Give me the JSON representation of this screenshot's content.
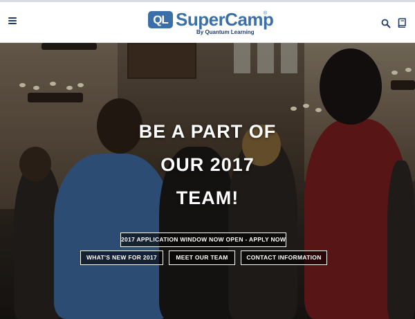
{
  "header": {
    "brand_mark": "QL",
    "brand_name": "SuperCamp",
    "brand_reg": "®",
    "brand_tagline": "By Quantum Learning",
    "icons": [
      "menu-icon",
      "search-icon",
      "book-icon"
    ],
    "colors": {
      "brand_blue": "#3a6fa8",
      "navy": "#1f3b66"
    }
  },
  "hero": {
    "headline_lines": [
      "BE A PART OF",
      "OUR 2017",
      "TEAM!"
    ],
    "buttons": {
      "apply": "2017 APPLICATION WINDOW NOW OPEN - APPLY NOW",
      "whats_new": "WHAT'S NEW FOR 2017",
      "meet_team": "MEET OUR TEAM",
      "contact": "CONTACT INFORMATION"
    }
  }
}
